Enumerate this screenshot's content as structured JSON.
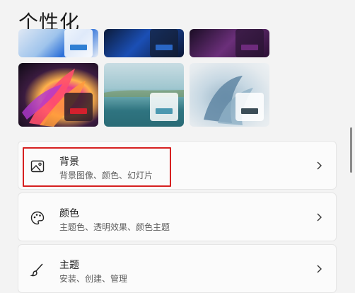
{
  "page": {
    "title": "个性化"
  },
  "themes": [
    {
      "name": "theme-1",
      "accent": "#2f7fd3"
    },
    {
      "name": "theme-2",
      "accent": "#2a66c4"
    },
    {
      "name": "theme-3",
      "accent": "#6e2b7d"
    },
    {
      "name": "theme-4",
      "accent": "#d3202d"
    },
    {
      "name": "theme-5",
      "accent": "#4a98b0"
    },
    {
      "name": "theme-6",
      "accent": "#3c4e58"
    }
  ],
  "settings": [
    {
      "title": "背景",
      "subtitle": "背景图像、颜色、幻灯片",
      "icon": "image-icon"
    },
    {
      "title": "颜色",
      "subtitle": "主题色、透明效果、颜色主题",
      "icon": "palette-icon"
    },
    {
      "title": "主题",
      "subtitle": "安装、创建、管理",
      "icon": "brush-icon"
    }
  ],
  "colors": {
    "highlight": "#d62020",
    "background": "#f3f3f3",
    "card": "#fbfbfb"
  }
}
